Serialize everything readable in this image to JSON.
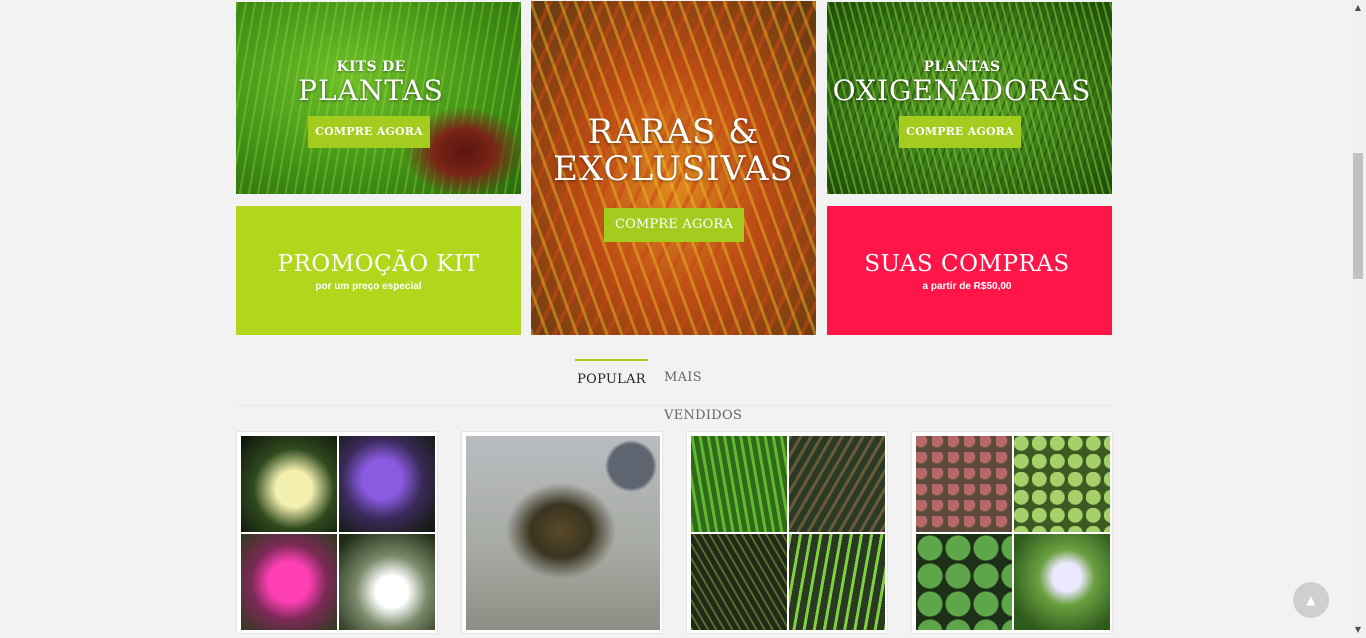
{
  "banners": {
    "kits": {
      "small": "KITS DE",
      "big": "PLANTAS",
      "button": "COMPRE AGORA"
    },
    "raras": {
      "line1": "RARAS &",
      "line2": "EXCLUSIVAS",
      "button": "COMPRE AGORA"
    },
    "oxigenadoras": {
      "small": "PLANTAS",
      "big": "OXIGENADORAS",
      "button": "COMPRE AGORA"
    },
    "promocao": {
      "title": "PROMOÇÃO KIT",
      "subtitle": "por um preço especial"
    },
    "compras": {
      "title": "SUAS COMPRAS",
      "subtitle": "a partir de R$50,00"
    }
  },
  "tabs": [
    {
      "label": "POPULAR",
      "active": true
    },
    {
      "label": "MAIS VENDIDOS",
      "active": false
    }
  ],
  "colors": {
    "accent": "#a3cc1e",
    "promo": "#b1d61b",
    "compras": "#ff1547"
  },
  "icons": {
    "scroll_top": "chevron-up-icon"
  }
}
